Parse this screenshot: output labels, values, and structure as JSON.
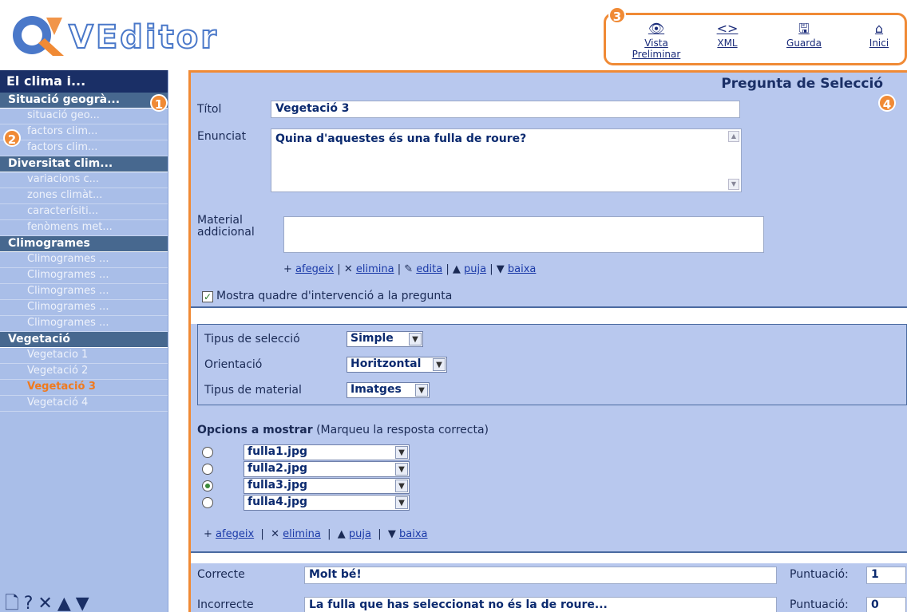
{
  "app": {
    "logo_letter": "Q",
    "logo_text": "VEditor"
  },
  "toolbar": {
    "preview": "Vista Preliminar",
    "xml": "XML",
    "save": "Guarda",
    "home": "Inici"
  },
  "badges": {
    "b1": "1",
    "b2": "2",
    "b3": "3",
    "b4": "4"
  },
  "sidebar": {
    "title": "El clima i...",
    "sections": [
      {
        "label": "Situació geogrà...",
        "items": [
          "situació geo...",
          "factors clim...",
          "factors clim..."
        ]
      },
      {
        "label": "Diversitat clim...",
        "items": [
          "variacions c...",
          "zones climàt...",
          "caracterísiti...",
          "fenòmens met..."
        ]
      },
      {
        "label": "Climogrames",
        "items": [
          "Climogrames ...",
          "Climogrames ...",
          "Climogrames ...",
          "Climogrames ...",
          "Climogrames ..."
        ]
      },
      {
        "label": "Vegetació",
        "items": [
          "Vegetacio 1",
          "Vegetació 2",
          "Vegetació 3",
          "Vegetació 4"
        ]
      }
    ],
    "active_item": "Vegetació 3"
  },
  "question": {
    "type_title": "Pregunta de Selecció",
    "title_label": "Títol",
    "title_value": "Vegetació 3",
    "statement_label": "Enunciat",
    "statement_value": "Quina d'aquestes és una fulla de roure?",
    "material_label_1": "Material",
    "material_label_2": "addicional",
    "material_actions": {
      "add": "afegeix",
      "remove": "elimina",
      "edit": "edita",
      "up": "puja",
      "down": "baixa"
    },
    "show_box_label": "Mostra quadre d'intervenció a la pregunta",
    "show_box_checked": true
  },
  "settings": {
    "selection_type_label": "Tipus de selecció",
    "selection_type_value": "Simple",
    "orientation_label": "Orientació",
    "orientation_value": "Horitzontal",
    "material_type_label": "Tipus de material",
    "material_type_value": "Imatges"
  },
  "options": {
    "heading": "Opcions a mostrar",
    "hint": "(Marqueu la resposta correcta)",
    "items": [
      {
        "value": "fulla1.jpg",
        "selected": false
      },
      {
        "value": "fulla2.jpg",
        "selected": false
      },
      {
        "value": "fulla3.jpg",
        "selected": true
      },
      {
        "value": "fulla4.jpg",
        "selected": false
      }
    ],
    "actions": {
      "add": "afegeix",
      "remove": "elimina",
      "up": "puja",
      "down": "baixa"
    }
  },
  "feedback": {
    "correct_label": "Correcte",
    "correct_value": "Molt bé!",
    "correct_score_label": "Puntuació:",
    "correct_score": "1",
    "incorrect_label": "Incorrecte",
    "incorrect_value": "La fulla que has seleccionat no és la de roure...",
    "incorrect_score_label": "Puntuació:",
    "incorrect_score": "0"
  },
  "colors": {
    "accent": "#f08a35",
    "navy": "#1a2f66",
    "panel": "#b8c8ee",
    "active": "#f07a1e"
  }
}
